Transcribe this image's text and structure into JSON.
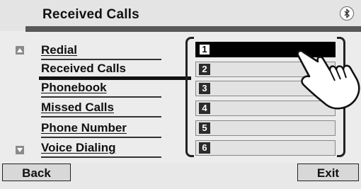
{
  "header": {
    "title": "Received Calls",
    "status_icon": "bluetooth-icon"
  },
  "menu": {
    "items": [
      {
        "label": "Redial"
      },
      {
        "label": "Received Calls",
        "active": true
      },
      {
        "label": "Phonebook"
      },
      {
        "label": "Missed Calls"
      },
      {
        "label": "Phone Number"
      },
      {
        "label": "Voice Dialing"
      }
    ],
    "scroll_up_icon": "triangle-up-icon",
    "scroll_down_icon": "triangle-down-icon"
  },
  "call_list": {
    "slots": [
      {
        "number": "1",
        "selected": true
      },
      {
        "number": "2"
      },
      {
        "number": "3"
      },
      {
        "number": "4"
      },
      {
        "number": "5"
      },
      {
        "number": "6"
      }
    ],
    "pointer_icon": "hand-pointer-icon"
  },
  "footer": {
    "back_label": "Back",
    "exit_label": "Exit"
  }
}
